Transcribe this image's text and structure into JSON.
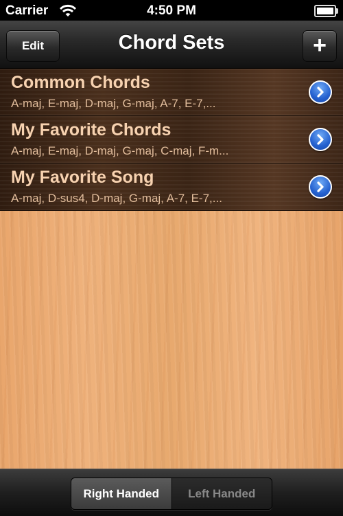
{
  "status_bar": {
    "carrier": "Carrier",
    "time": "4:50 PM"
  },
  "nav": {
    "title": "Chord Sets",
    "edit_label": "Edit",
    "add_label": "+"
  },
  "chord_sets": [
    {
      "name": "Common Chords",
      "chords": "A-maj, E-maj, D-maj, G-maj, A-7, E-7,..."
    },
    {
      "name": "My Favorite Chords",
      "chords": "A-maj, E-maj, D-maj, G-maj, C-maj, F-m..."
    },
    {
      "name": "My Favorite Song",
      "chords": "A-maj, D-sus4, D-maj, G-maj, A-7, E-7,..."
    }
  ],
  "toolbar": {
    "segments": [
      {
        "label": "Right Handed",
        "selected": true
      },
      {
        "label": "Left Handed",
        "selected": false
      }
    ]
  },
  "colors": {
    "accent": "#2561cf",
    "row_title": "#f7d2b0",
    "wood": "#efb27c"
  }
}
